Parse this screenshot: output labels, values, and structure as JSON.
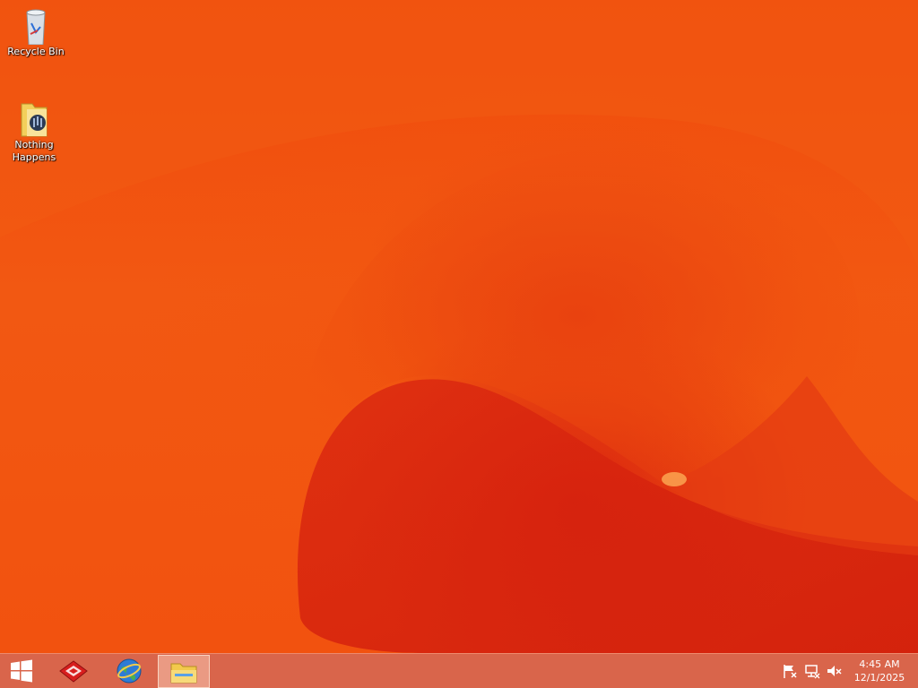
{
  "desktop": {
    "icons": [
      {
        "label": "Recycle Bin",
        "icon": "recycle-bin-icon"
      },
      {
        "label": "Nothing Happens",
        "icon": "music-folder-icon"
      }
    ]
  },
  "taskbar": {
    "start": {
      "icon": "windows-logo-icon"
    },
    "apps": [
      {
        "icon": "red-diamond-app-icon",
        "active": false
      },
      {
        "icon": "globe-browser-icon",
        "active": false
      },
      {
        "icon": "file-explorer-icon",
        "active": true
      }
    ],
    "tray": {
      "icons": [
        "action-center-flag-icon",
        "network-icon",
        "volume-muted-icon"
      ]
    },
    "clock": {
      "time": "4:45 AM",
      "date": "12/1/2025"
    }
  },
  "colors": {
    "wallpaper_base": "#f2520f",
    "wallpaper_dark": "#d8220f",
    "taskbar": "#d6583c"
  }
}
